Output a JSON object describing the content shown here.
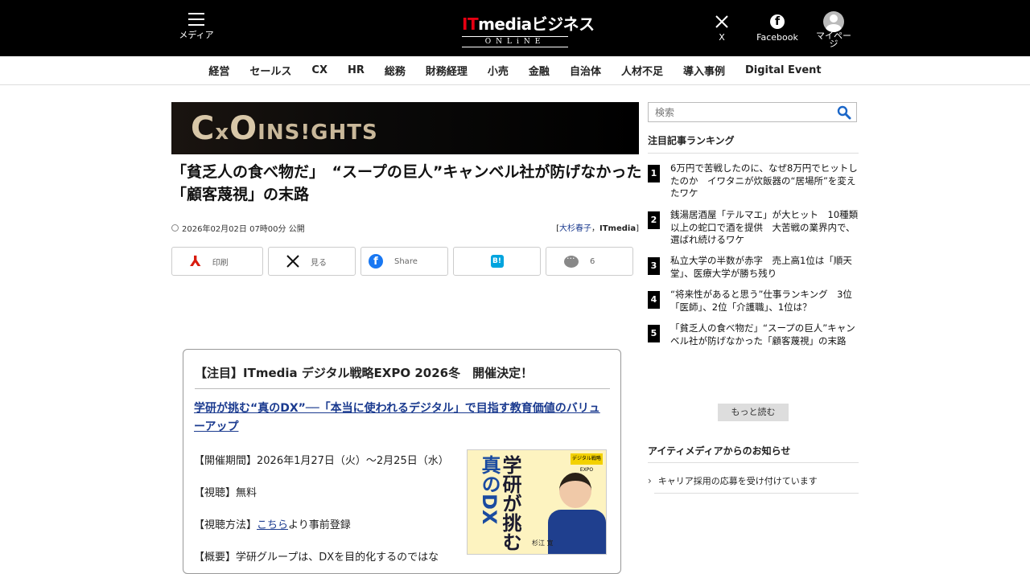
{
  "header": {
    "menu_label": "メディア",
    "logo_main_it": "IT",
    "logo_main_rest": "mediaビジネス",
    "logo_sub": "ONLiNE",
    "x_label": "X",
    "facebook_label": "Facebook",
    "mypage_label": "マイページ"
  },
  "nav": {
    "items": [
      "経営",
      "セールス",
      "CX",
      "HR",
      "総務",
      "財務経理",
      "小売",
      "金融",
      "自治体",
      "人材不足",
      "導入事例",
      "Digital Event"
    ]
  },
  "banner": {
    "prefix": "C",
    "x": "x",
    "o": "O",
    "rest": "INS!GHTS"
  },
  "article": {
    "title": "「貧乏人の食べ物だ」　“スープの巨人”キャンベル社が防げなかった「顧客蔑視」の末路",
    "date": "2026年02月02日 07時00分 公開",
    "author_open": "[",
    "author_name": "大杉春子",
    "author_sep": "，",
    "author_org": "ITmedia",
    "author_close": "]"
  },
  "share": {
    "print": "印刷",
    "x": "見る",
    "facebook": "Share",
    "hatena": "B!",
    "comments": "6"
  },
  "promo": {
    "heading": "【注目】ITmedia デジタル戦略EXPO 2026冬　開催決定！",
    "link": "学研が挑む“真のDX”──「本当に使われるデジタル」で目指す教育価値のバリューアップ",
    "period": "【開催期間】2026年1月27日（火）～2月25日（水）",
    "fee": "【視聴】無料",
    "method_prefix": "【視聴方法】",
    "method_link": "こちら",
    "method_suffix": "より事前登録",
    "summary": "【概要】学研グループは、DXを目的化するのではな",
    "image": {
      "title_part1": "学研が挑む",
      "title_part2": "真のDX",
      "badge": "デジタル戦略EXPO",
      "name": "杉江 寛"
    }
  },
  "sidebar": {
    "search_placeholder": "検索",
    "ranking_title": "注目記事ランキング",
    "ranking": [
      {
        "num": "1",
        "text": "6万円で苦戦したのに、なぜ8万円でヒットしたのか　イワタニが炊飯器の“居場所”を変えたワケ"
      },
      {
        "num": "2",
        "text": "銭湯居酒屋「テルマエ」が大ヒット　10種類以上の蛇口で酒を提供　大苦戦の業界内で、選ばれ続けるワケ"
      },
      {
        "num": "3",
        "text": "私立大学の半数が赤字　売上高1位は「順天堂」、医療大学が勝ち残り"
      },
      {
        "num": "4",
        "text": "“将来性があると思う”仕事ランキング　3位「医師」、2位「介護職」、1位は？"
      },
      {
        "num": "5",
        "text": "「貧乏人の食べ物だ」“スープの巨人”キャンベル社が防げなかった「顧客蔑視」の末路"
      }
    ],
    "more_label": "もっと読む",
    "notice_title": "アイティメディアからのお知らせ",
    "notice_item": "キャリア採用の応募を受け付けています"
  },
  "colors": {
    "accent_red": "#e60012",
    "link_blue": "#1a3a8f",
    "facebook_blue": "#1877f2",
    "search_icon_blue": "#1a66c8"
  }
}
